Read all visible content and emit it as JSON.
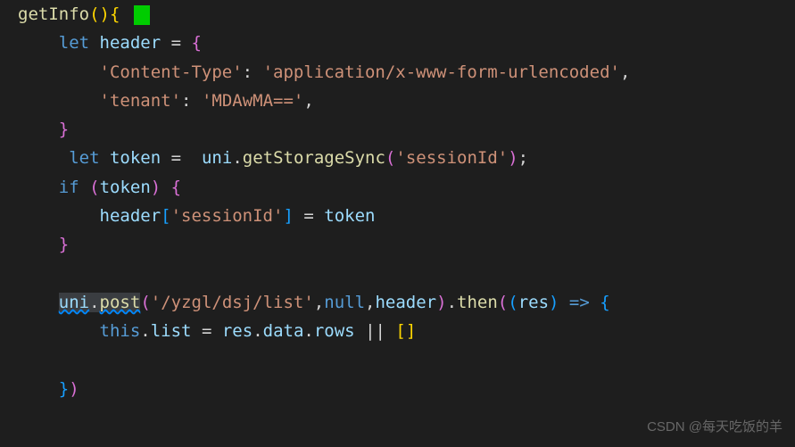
{
  "code": {
    "fnName": "getInfo",
    "letKw": "let",
    "ifKw": "if",
    "thisKw": "this",
    "nullKw": "null",
    "headerVar": "header",
    "tokenVar": "token",
    "uniObj": "uni",
    "resVar": "res",
    "listProp": "list",
    "dataProp": "data",
    "rowsProp": "rows",
    "getStorageFn": "getStorageSync",
    "postFn": "post",
    "thenFn": "then",
    "contentTypeKey": "'Content-Type'",
    "contentTypeVal": "'application/x-www-form-urlencoded'",
    "tenantKey": "'tenant'",
    "tenantVal": "'MDAwMA=='",
    "sessionIdStr": "'sessionId'",
    "urlStr": "'/yzgl/dsj/list'",
    "emptyArr": "[]"
  },
  "watermark": "CSDN @每天吃饭的羊"
}
